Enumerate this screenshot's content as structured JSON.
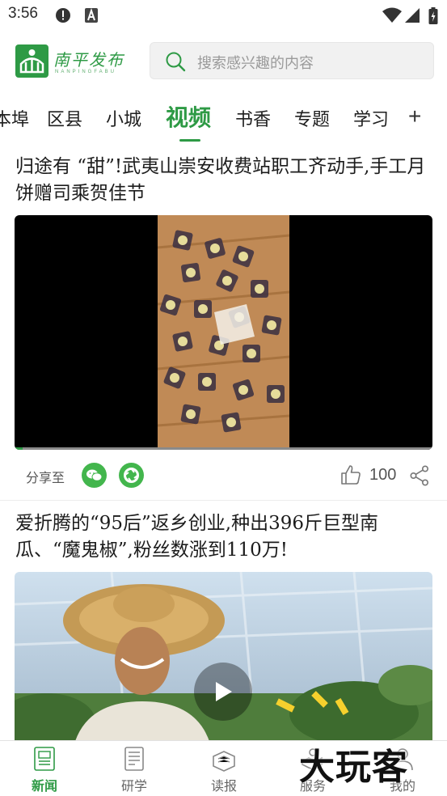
{
  "status_bar": {
    "time": "3:56",
    "icons": [
      "alert-icon",
      "a-icon",
      "wifi-icon",
      "signal-icon",
      "battery-icon"
    ]
  },
  "header": {
    "logo_text": "南平发布",
    "logo_sub": "NANPINGFABU",
    "search_placeholder": "搜索感兴趣的内容"
  },
  "tabs": [
    {
      "label": "本埠"
    },
    {
      "label": "区县"
    },
    {
      "label": "小城"
    },
    {
      "label": "视频",
      "active": true
    },
    {
      "label": "书香"
    },
    {
      "label": "专题"
    },
    {
      "label": "学习"
    }
  ],
  "articles": [
    {
      "title": "归途有 “甜”!武夷山崇安收费站职工齐动手,手工月饼赠司乘贺佳节",
      "media": "video",
      "progress": 0.02,
      "share_label": "分享至",
      "share_targets": [
        "wechat-icon",
        "moments-icon"
      ],
      "likes": "100"
    },
    {
      "title": "爱折腾的“95后”返乡创业,种出396斤巨型南瓜、“魔鬼椒”,粉丝数涨到110万!",
      "media": "video"
    }
  ],
  "bottom_nav": [
    {
      "label": "新闻",
      "active": true
    },
    {
      "label": "研学"
    },
    {
      "label": "读报"
    },
    {
      "label": "服务"
    },
    {
      "label": "我的"
    }
  ],
  "watermark": "大玩客",
  "colors": {
    "accent": "#2e9a45",
    "share_green": "#43b64d"
  }
}
